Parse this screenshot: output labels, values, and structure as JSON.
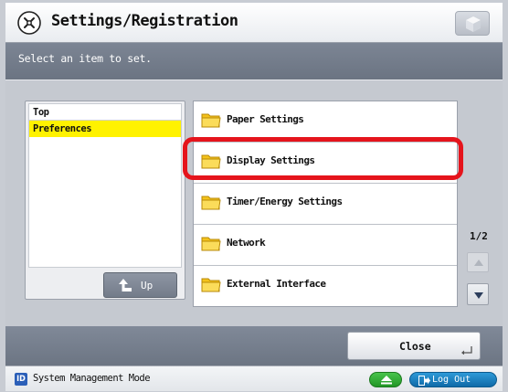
{
  "header": {
    "title": "Settings/Registration",
    "title_icon": "settings-registration-icon",
    "right_button_icon": "cube-icon"
  },
  "instruction": "Select an item to set.",
  "tree": {
    "items": [
      {
        "label": "Top",
        "selected": false
      },
      {
        "label": "Preferences",
        "selected": true
      }
    ],
    "up_button": "Up"
  },
  "list": {
    "items": [
      {
        "label": "Paper Settings",
        "icon": "folder-icon"
      },
      {
        "label": "Display Settings",
        "icon": "folder-icon",
        "highlighted": true
      },
      {
        "label": "Timer/Energy Settings",
        "icon": "folder-icon"
      },
      {
        "label": "Network",
        "icon": "folder-icon"
      },
      {
        "label": "External Interface",
        "icon": "folder-icon"
      }
    ]
  },
  "pager": {
    "page": "1/2"
  },
  "footer": {
    "close_label": "Close"
  },
  "status": {
    "mode": "System Management Mode",
    "id_badge": "ID",
    "logout_label": "Log Out"
  },
  "colors": {
    "selection": "#fff200",
    "highlight_border": "#e5141c",
    "logout": "#1f7fc0",
    "eject": "#35b038"
  }
}
